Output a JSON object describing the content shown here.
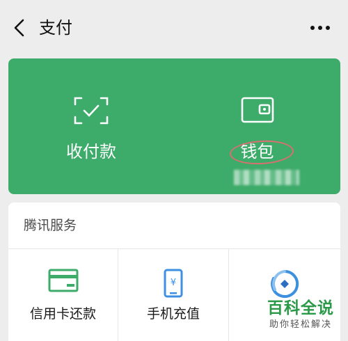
{
  "nav": {
    "title": "支付"
  },
  "wallet_card": {
    "background": "#3dab6a",
    "items": [
      {
        "label": "收付款",
        "icon": "scan-qr-icon"
      },
      {
        "label": "钱包",
        "icon": "wallet-icon"
      }
    ],
    "annotation_color": "#d9706f"
  },
  "services": {
    "title": "腾讯服务",
    "items": [
      {
        "label": "信用卡还款",
        "icon": "credit-card-icon",
        "color": "#3dab6a"
      },
      {
        "label": "手机充值",
        "icon": "phone-recharge-icon",
        "color": "#3d8fe0"
      },
      {
        "label": "",
        "icon": "wealth-icon",
        "color": "#3d8fe0"
      }
    ]
  },
  "watermark": {
    "main": "百科全说",
    "sub": "助你轻松解决"
  }
}
